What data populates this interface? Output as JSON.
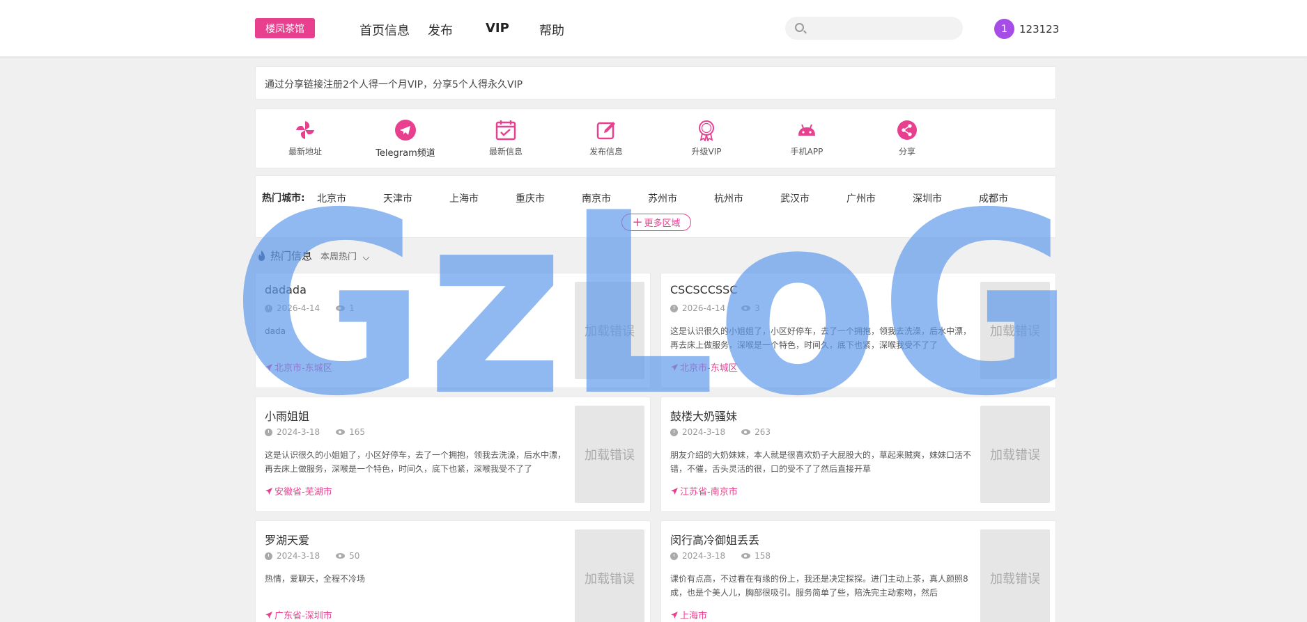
{
  "header": {
    "logo": "楼凤茶馆",
    "nav": [
      "首页信息",
      "发布",
      "VIP",
      "帮助"
    ],
    "search_placeholder": "",
    "avatar_text": "1",
    "username": "123123"
  },
  "notice": "通过分享链接注册2个人得一个月VIP，分享5个人得永久VIP",
  "quick_links": [
    {
      "label": "最新地址",
      "icon": "pinwheel-icon"
    },
    {
      "label": "Telegram频道",
      "icon": "telegram-icon"
    },
    {
      "label": "最新信息",
      "icon": "calendar-check-icon"
    },
    {
      "label": "发布信息",
      "icon": "edit-icon"
    },
    {
      "label": "升级VIP",
      "icon": "vip-badge-icon"
    },
    {
      "label": "手机APP",
      "icon": "android-icon"
    },
    {
      "label": "分享",
      "icon": "share-icon"
    }
  ],
  "cities": {
    "label": "热门城市:",
    "items": [
      "北京市",
      "天津市",
      "上海市",
      "重庆市",
      "南京市",
      "苏州市",
      "杭州市",
      "武汉市",
      "广州市",
      "深圳市",
      "成都市"
    ],
    "more": "更多区域"
  },
  "hot": {
    "title": "热门信息",
    "filter": "本周热门"
  },
  "posts": [
    {
      "title": "dadada",
      "date": "2026-4-14",
      "views": "1",
      "desc": "dada",
      "location": "北京市-东城区",
      "thumb": "加载错误"
    },
    {
      "title": "CSCSCCSSC",
      "date": "2026-4-14",
      "views": "3",
      "desc": "这是认识很久的小姐姐了，小区好停车，去了一个拥抱，领我去洗澡，后水中漂，再去床上做服务，深喉是一个特色，时间久，底下也紧，深喉我受不了了",
      "location": "北京市-东城区",
      "thumb": "加载错误"
    },
    {
      "title": "小雨姐姐",
      "date": "2024-3-18",
      "views": "165",
      "desc": "这是认识很久的小姐姐了，小区好停车，去了一个拥抱，领我去洗澡，后水中漂，再去床上做服务，深喉是一个特色，时间久，底下也紧，深喉我受不了了",
      "location": "安徽省-芜湖市",
      "thumb": "加载错误"
    },
    {
      "title": "鼓楼大奶骚妹",
      "date": "2024-3-18",
      "views": "263",
      "desc": "朋友介绍的大奶妹妹，本人就是很喜欢奶子大屁股大的，草起来贼爽，妹妹口活不错，不催，舌头灵活的很，口的受不了了然后直接开草",
      "location": "江苏省-南京市",
      "thumb": "加载错误"
    },
    {
      "title": "罗湖天爱",
      "date": "2024-3-18",
      "views": "50",
      "desc": "热情，爱聊天，全程不冷场",
      "location": "广东省-深圳市",
      "thumb": "加载错误"
    },
    {
      "title": "闵行高冷御姐丢丢",
      "date": "2024-3-18",
      "views": "158",
      "desc": "课价有点高，不过看在有缘的份上，我还是决定探探。进门主动上茶，真人颜照8成，也是个美人儿，胸部很吸引。服务简单了些，陪洗完主动索吻，然后",
      "location": "上海市",
      "thumb": "加载错误"
    }
  ],
  "watermark": "GzLoG",
  "colors": {
    "accent": "#e8408f",
    "avatar": "#a64de8",
    "watermark": "#5b98ec"
  }
}
